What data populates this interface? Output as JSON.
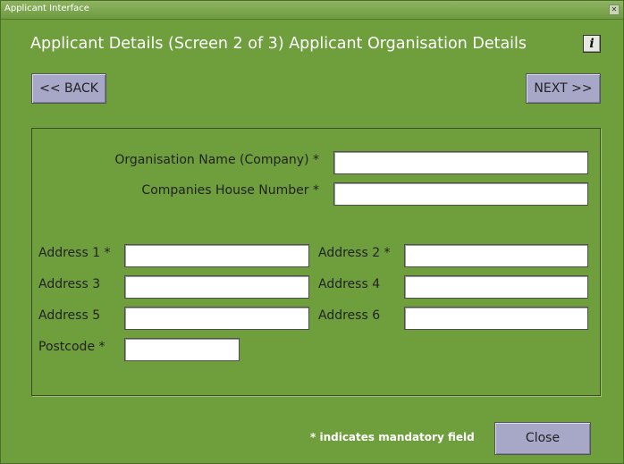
{
  "window": {
    "title": "Applicant Interface",
    "close_glyph": "✕"
  },
  "heading": "Applicant Details (Screen 2 of 3) Applicant Organisation Details",
  "info_glyph": "i",
  "nav": {
    "back_label": "<< BACK",
    "next_label": "NEXT >>"
  },
  "form": {
    "org_name_label": "Organisation Name (Company) *",
    "org_name_value": "",
    "companies_house_label": "Companies House Number *",
    "companies_house_value": "",
    "address1_label": "Address 1 *",
    "address2_label": "Address 2 *",
    "address3_label": "Address 3",
    "address4_label": "Address 4",
    "address5_label": "Address 5",
    "address6_label": "Address 6",
    "postcode_label": "Postcode *"
  },
  "footer": {
    "note": "* indicates mandatory field",
    "close_label": "Close"
  },
  "colors": {
    "background": "#6f9f3c",
    "button": "#a7a8c8",
    "heading_text": "#ffffff"
  }
}
